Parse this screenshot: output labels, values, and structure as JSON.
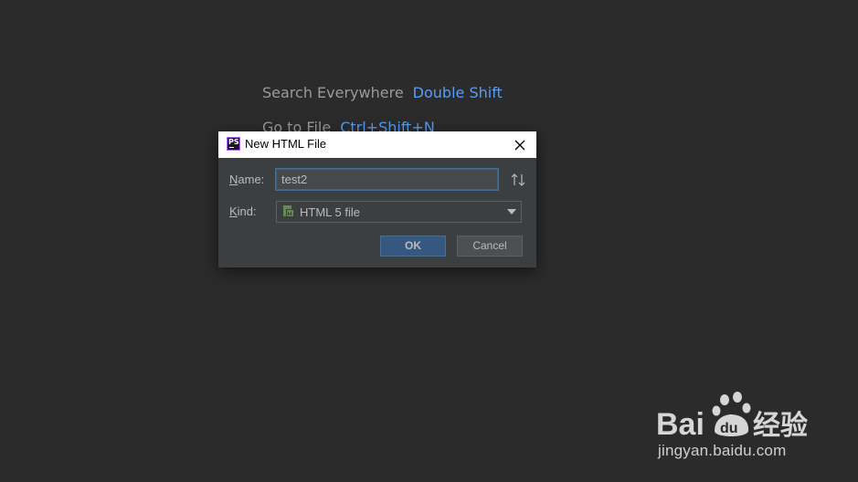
{
  "background_hints": [
    {
      "label": "Search Everywhere",
      "shortcut": "Double Shift"
    },
    {
      "label": "Go to File",
      "shortcut": "Ctrl+Shift+N"
    }
  ],
  "dialog": {
    "title": "New HTML File",
    "app_icon": "phpstorm-icon",
    "name": {
      "label_mnemonic": "N",
      "label_rest": "ame:",
      "value": "test2"
    },
    "kind": {
      "label_mnemonic": "K",
      "label_rest": "ind:",
      "selected": "HTML 5 file"
    },
    "ok_label": "OK",
    "cancel_label": "Cancel"
  },
  "watermark": {
    "text": "jingyan.baidu.com"
  },
  "colors": {
    "background": "#2b2b2b",
    "dialog": "#3c3f41",
    "accent": "#589df6",
    "ok_button": "#365880"
  }
}
